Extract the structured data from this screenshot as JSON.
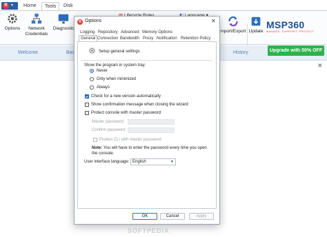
{
  "app": {
    "tabs": [
      "Home",
      "Tools",
      "Disk Capacity"
    ],
    "active_tab": "Tools",
    "ribbon": {
      "options_label": "Options",
      "network_label_1": "Network",
      "network_label_2": "Credentials",
      "diagnostic_label": "Diagnostic",
      "lifecycle_label": "Lifecycle Rules",
      "language_label": "Language",
      "import_export_label": "mport/Export",
      "update_label": "Update"
    },
    "logo": {
      "text": "MSP360",
      "tagline": "MANAGE. SUPPORT. PROTECT"
    },
    "upgrade_label": "Upgrade with 50% OFF",
    "nav": {
      "welcome": "Welcome",
      "back": "Bac",
      "history": "History"
    },
    "close_glyph": "✕",
    "watermark": "SOFTPEDIA",
    "colors": {
      "accent": "#1f5fbf",
      "upgrade": "#2db34a",
      "brand_red": "#e8392c",
      "brand_blue": "#1d4f91"
    }
  },
  "dialog": {
    "title": "Options",
    "close_glyph": "✕",
    "tabs_row1": [
      "Logging",
      "Repository",
      "Advanced",
      "Memory Options"
    ],
    "tabs_row2": [
      "General",
      "Connection",
      "Bandwidth",
      "Proxy",
      "Notification",
      "Retention Policy"
    ],
    "selected_tab": "General",
    "header": "Setup general settings",
    "tray_label": "Show the program in system tray:",
    "tray_options": [
      {
        "label": "Never",
        "selected": true
      },
      {
        "label": "Only when minimized",
        "selected": false
      },
      {
        "label": "Always",
        "selected": false
      }
    ],
    "check_version": {
      "label": "Check for a new version automatically",
      "checked": true
    },
    "show_confirmation": {
      "label": "Show confirmation message when closing the wizard",
      "checked": false
    },
    "protect_console": {
      "label": "Protect console with master password",
      "checked": false
    },
    "master_password_label": "Master password:",
    "confirm_password_label": "Confirm password:",
    "protect_cli": {
      "label": "Protect CLI with master password",
      "checked": false
    },
    "note_bold": "Note:",
    "note_line1": "You will have to enter the password every time you open",
    "note_line2": "the console.",
    "language_label": "User interface language:",
    "language_value": "English",
    "buttons": {
      "ok": "OK",
      "cancel": "Cancel",
      "apply": "Apply"
    }
  }
}
